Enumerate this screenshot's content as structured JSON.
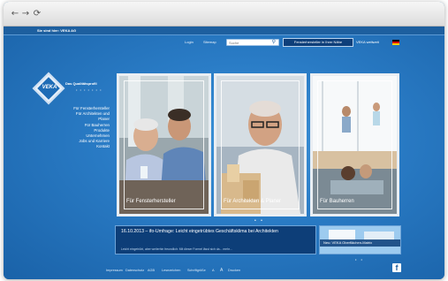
{
  "browser": {
    "back_icon": "back-arrow-icon",
    "forward_icon": "forward-arrow-icon",
    "reload_icon": "reload-icon",
    "back_glyph": "←",
    "forward_glyph": "→",
    "reload_glyph": "⟳"
  },
  "topbar": {
    "text": "Sie sind hier: VEKA AG"
  },
  "util": {
    "login": "Login",
    "sitemap": "Sitemap",
    "search_placeholder": "Suche",
    "search_glyph": "⚲",
    "dealer_button": "Fensterhersteller in Ihrer Nähe",
    "worldwide": "VEKA weltweit",
    "flag_icon": "german-flag-icon"
  },
  "logo": {
    "text": "VEKA",
    "tagline": "Das Qualitätsprofil",
    "dots": "• • • • • • •"
  },
  "menu": {
    "items": [
      "Für Fensterhersteller",
      "Für Architekten und",
      "Planer",
      "Für Bauherren",
      "Produkte",
      "Unternehmen",
      "Jobs und Karriere",
      "Kontakt"
    ]
  },
  "panels": [
    {
      "label": "Für Fensterhersteller"
    },
    {
      "label": "Für Architekten & Planer"
    },
    {
      "label": "Für Bauherren"
    }
  ],
  "carousel_dots": "• •",
  "news": {
    "title": "16.10.2013 – ifo-Umfrage: Leicht eingetrübtes Geschäftsklima bei Architekten",
    "text": "Leicht eingetrübt, aber weiterhin freundlich: Mit dieser Formel lässt sich da...    mehr..."
  },
  "promo": {
    "label": "Neu: VEKA Oberflächen-Matrix"
  },
  "news_dots": "• •",
  "footer": {
    "links": [
      "Impressum",
      "Datenschutz",
      "AGB",
      "Lesezeichen",
      "Schriftgröße",
      "A",
      "A",
      "Drucken"
    ],
    "facebook_icon": "facebook-icon",
    "facebook_glyph": "f"
  },
  "colors": {
    "brand_blue": "#1f6fb6",
    "dark_blue": "#0d3e78",
    "topbar": "#1d5f9f"
  }
}
